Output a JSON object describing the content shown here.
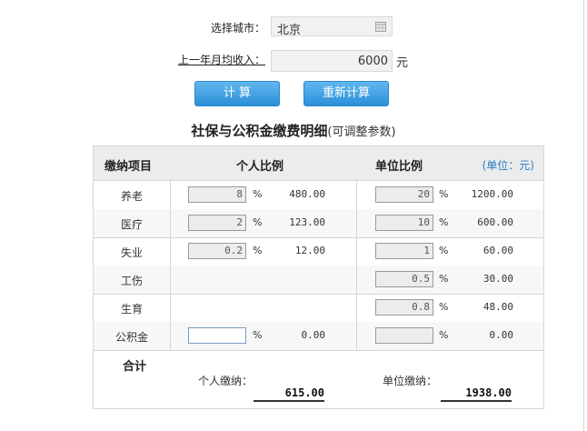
{
  "form": {
    "city_label": "选择城市：",
    "city_value": "北京",
    "income_label": "上一年月均收入：",
    "income_value": "6000",
    "income_unit": "元"
  },
  "buttons": {
    "calculate": "计  算",
    "recalculate": "重新计算"
  },
  "table": {
    "title": "社保与公积金缴费明细",
    "subtitle": "(可调整参数)",
    "headers": {
      "item": "缴纳项目",
      "personal": "个人比例",
      "company": "单位比例",
      "unit_note": "(单位：元)"
    },
    "percent_sign": "%",
    "rows": [
      {
        "name": "养老",
        "personal_rate": "8",
        "personal_amount": "480.00",
        "company_rate": "20",
        "company_amount": "1200.00"
      },
      {
        "name": "医疗",
        "personal_rate": "2",
        "personal_amount": "123.00",
        "company_rate": "10",
        "company_amount": "600.00"
      },
      {
        "name": "失业",
        "personal_rate": "0.2",
        "personal_amount": "12.00",
        "company_rate": "1",
        "company_amount": "60.00"
      },
      {
        "name": "工伤",
        "company_rate": "0.5",
        "company_amount": "30.00"
      },
      {
        "name": "生育",
        "company_rate": "0.8",
        "company_amount": "48.00"
      },
      {
        "name": "公积金",
        "personal_rate": "",
        "personal_amount": "0.00",
        "company_rate": "",
        "company_amount": "0.00"
      }
    ],
    "total": {
      "label": "合计",
      "personal_label": "个人缴纳：",
      "personal_value": "615.00",
      "company_label": "单位缴纳：",
      "company_value": "1938.00"
    }
  },
  "colors": {
    "button": "#2b8fd9",
    "unit_note": "#2b7bc0",
    "header_bg": "#ececec"
  }
}
